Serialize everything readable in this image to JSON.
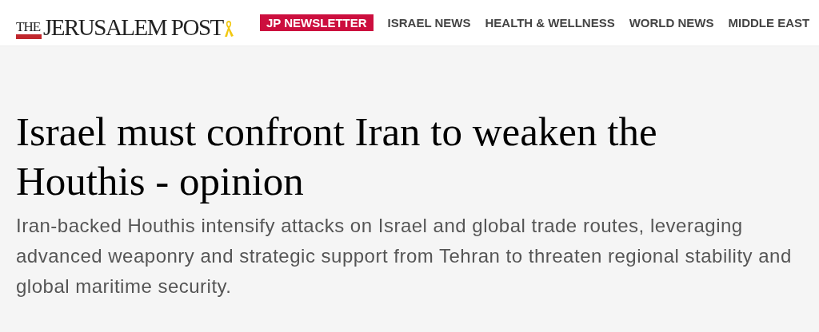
{
  "header": {
    "logo": {
      "small": "THE",
      "main": "JERUSALEM POST"
    },
    "nav": [
      {
        "label": "JP NEWSLETTER",
        "kind": "highlight"
      },
      {
        "label": "ISRAEL NEWS",
        "kind": "plain"
      },
      {
        "label": "HEALTH & WELLNESS",
        "kind": "plain"
      },
      {
        "label": "WORLD NEWS",
        "kind": "plain"
      },
      {
        "label": "MIDDLE EAST",
        "kind": "plain"
      }
    ]
  },
  "article": {
    "headline": "Israel must confront Iran to weaken the Houthis - opinion",
    "summary": "Iran-backed Houthis intensify attacks on Israel and global trade routes, leveraging advanced weaponry and strategic support from Tehran to threaten regional stability and global maritime security."
  }
}
